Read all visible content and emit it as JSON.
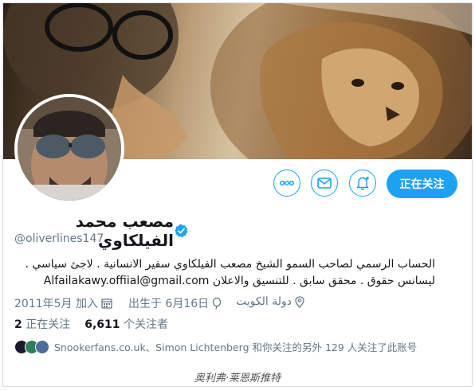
{
  "header": {
    "follow_button_label": "正在关注",
    "more_label": "More",
    "message_label": "Message",
    "notify_label": "Notifications"
  },
  "profile": {
    "display_name": "مصعب محمد الفيلكاوي",
    "handle": "@oliverlines147",
    "bio_line1": "الحساب الرسمي لصاحب السمو الشيخ مصعب الفيلكاوي سفير الانسانية . لاجئ سياسي .",
    "bio_line2": "ليسانس حقوق . محقق سابق . للتنسيق والاعلان Alfailakawy.offiial@gmail.com",
    "joined": "2011年5月 加入",
    "born": "出生于 6月16日",
    "location": "دولة الكويت"
  },
  "stats": {
    "following_count": "2",
    "following_label": "正在关注",
    "followers_count": "6,611",
    "followers_label": "个关注者"
  },
  "followed_by": {
    "text": "Snookerfans.co.uk、Simon Lichtenberg 和你关注的另外 129 人关注了此账号"
  },
  "caption": "奥利弗·莱恩斯推特",
  "colors": {
    "accent": "#1da1f2",
    "text_secondary": "#657786"
  },
  "icons": [
    "more-icon",
    "message-icon",
    "bell-plus-icon",
    "verified-icon",
    "calendar-icon",
    "balloon-icon",
    "location-pin-icon"
  ]
}
